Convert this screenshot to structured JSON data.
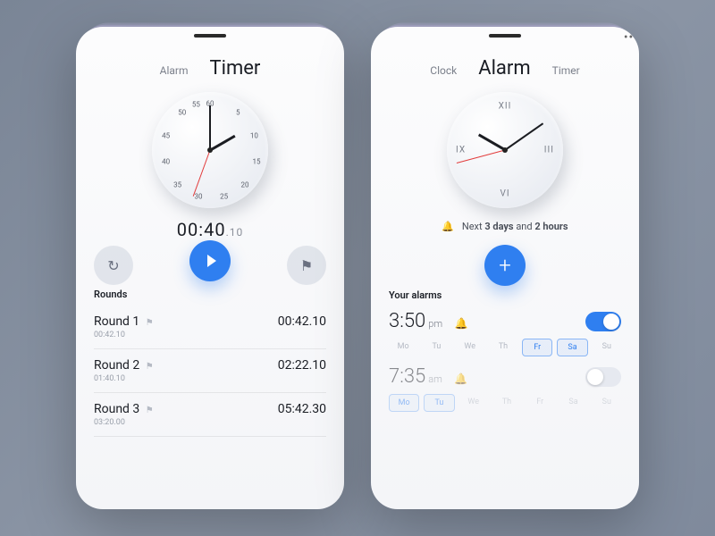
{
  "timer_screen": {
    "tabs": {
      "alarm": "Alarm",
      "timer": "Timer"
    },
    "dial_numbers": [
      "55",
      "60",
      "5",
      "50",
      "10",
      "45",
      "15",
      "40",
      "20",
      "35",
      "30",
      "25"
    ],
    "readout_main": "00:40",
    "readout_ms": ".10",
    "rounds_label": "Rounds",
    "rounds": [
      {
        "title": "Round 1",
        "sub": "00:42.10",
        "time": "00:42.10"
      },
      {
        "title": "Round 2",
        "sub": "01:40.10",
        "time": "02:22.10"
      },
      {
        "title": "Round 3",
        "sub": "03:20.00",
        "time": "05:42.30"
      }
    ]
  },
  "alarm_screen": {
    "tabs": {
      "clock": "Clock",
      "alarm": "Alarm",
      "timer": "Timer"
    },
    "romans": {
      "twelve": "XII",
      "three": "III",
      "six": "VI",
      "nine": "IX"
    },
    "next_prefix": "Next",
    "next_days": "3 days",
    "next_and": "and",
    "next_hours": "2 hours",
    "list_label": "Your alarms",
    "days": [
      "Mo",
      "Tu",
      "We",
      "Th",
      "Fr",
      "Sa",
      "Su"
    ],
    "alarms": [
      {
        "time": "3:50",
        "ampm": "pm",
        "on": true,
        "days_on": [
          4,
          5
        ]
      },
      {
        "time": "7:35",
        "ampm": "am",
        "on": false,
        "days_on": [
          0,
          1
        ]
      }
    ]
  }
}
